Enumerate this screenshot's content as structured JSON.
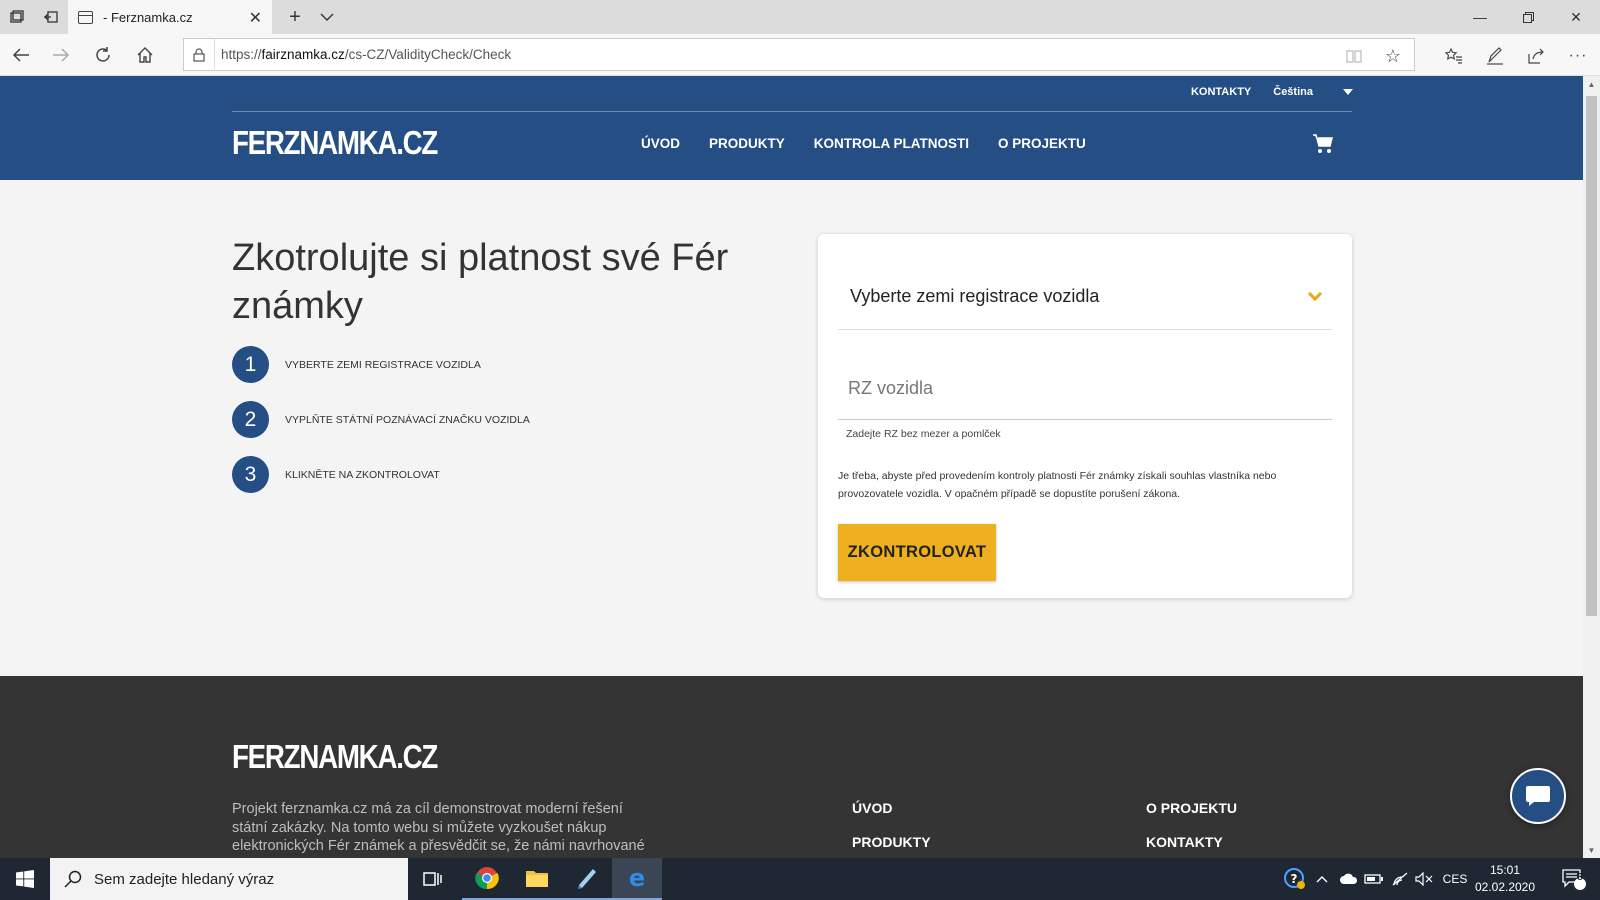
{
  "browser": {
    "tab_title": "- Ferznamka.cz",
    "url_prefix": "https://",
    "url_host": "fairznamka.cz",
    "url_path": "/cs-CZ/ValidityCheck/Check"
  },
  "header": {
    "top_links": {
      "contacts": "KONTAKTY",
      "language": "Čeština"
    },
    "logo": "FERZNAMKA.CZ",
    "nav": [
      "ÚVOD",
      "PRODUKTY",
      "KONTROLA PLATNOSTI",
      "O PROJEKTU"
    ]
  },
  "hero": {
    "title": "Zkotrolujte si platnost své Fér známky",
    "steps": [
      {
        "num": "1",
        "text": "VYBERTE ZEMI REGISTRACE VOZIDLA"
      },
      {
        "num": "2",
        "text": "VYPLŇTE STÁTNÍ POZNÁVACÍ ZNAČKU VOZIDLA"
      },
      {
        "num": "3",
        "text": "KLIKNĚTE NA ZKONTROLOVAT"
      }
    ]
  },
  "form": {
    "country_select": "Vyberte zemi registrace vozidla",
    "rz_placeholder": "RZ vozidla",
    "rz_hint": "Zadejte RZ bez mezer a pomlček",
    "consent": "Je třeba, abyste před provedením kontroly platnosti Fér známky získali souhlas vlastníka nebo provozovatele vozidla. V opačném případě se dopustíte porušení zákona.",
    "submit": "ZKONTROLOVAT"
  },
  "footer": {
    "logo": "FERZNAMKA.CZ",
    "description": "Projekt ferznamka.cz má za cíl demonstrovat moderní řešení státní zakázky. Na tomto webu si můžete vyzkoušet nákup elektronických Fér známek a přesvědčit se, že námi navrhované",
    "col1": [
      "ÚVOD",
      "PRODUKTY"
    ],
    "col2": [
      "O PROJEKTU",
      "KONTAKTY"
    ]
  },
  "taskbar": {
    "search_placeholder": "Sem zadejte hledaný výraz",
    "language": "CES",
    "time": "15:01",
    "date": "02.02.2020",
    "notification_count": "3"
  },
  "colors": {
    "brand_blue": "#244e84",
    "accent_yellow": "#eeb01f",
    "footer_bg": "#343434"
  }
}
